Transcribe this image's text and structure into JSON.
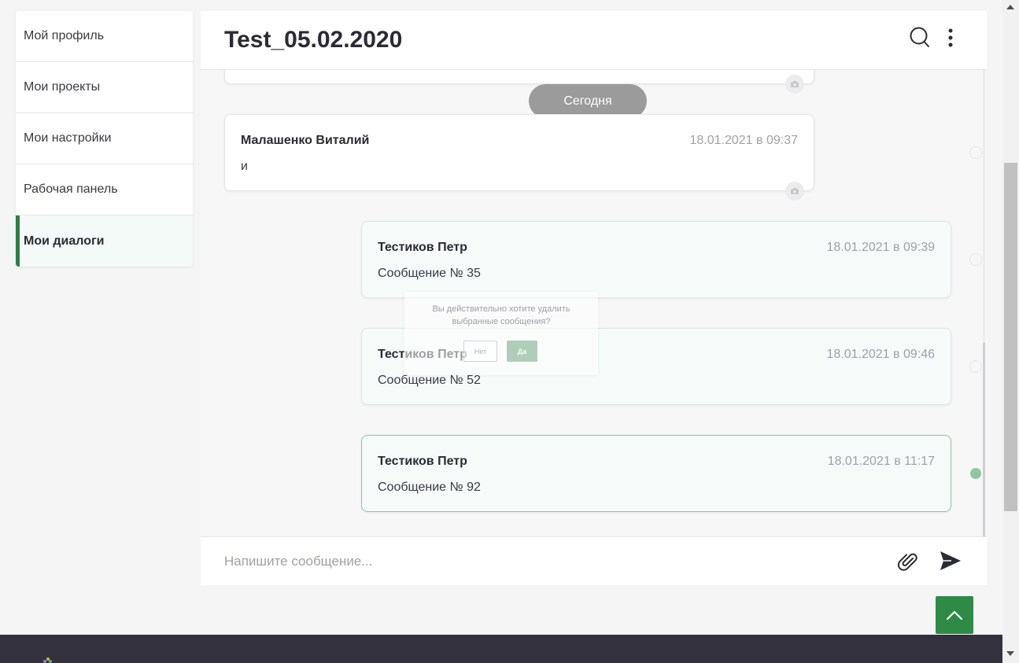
{
  "sidebar": {
    "items": [
      {
        "label": "Мой профиль"
      },
      {
        "label": "Мои проекты"
      },
      {
        "label": "Мои настройки"
      },
      {
        "label": "Рабочая панель"
      },
      {
        "label": "Мои диалоги",
        "active": true
      }
    ]
  },
  "chat": {
    "title": "Test_05.02.2020",
    "header_icons": [
      "search-icon",
      "more-vertical-icon"
    ],
    "day_separator": "Сегодня",
    "messages": [
      {
        "author": "Малашенко Виталий",
        "time": "18.01.2021 в 09:37",
        "text": "и"
      },
      {
        "author": "Тестиков Петр",
        "time": "18.01.2021 в 09:39",
        "text": "Сообщение № 35"
      },
      {
        "author": "Тестиков Петр",
        "time": "18.01.2021 в 09:46",
        "text": "Сообщение № 52"
      },
      {
        "author": "Тестиков Петр",
        "time": "18.01.2021 в 11:17",
        "text": "Сообщение № 92",
        "selected": true
      }
    ],
    "confirm_dialog": {
      "text": "Вы действительно хотите удалить выбранные сообщения?",
      "no_label": "Нет",
      "yes_label": "Да"
    },
    "composer": {
      "placeholder": "Напишите сообщение...",
      "icons": [
        "paperclip-icon",
        "send-icon"
      ]
    }
  },
  "colors": {
    "accent": "#2e8b45",
    "selected_dot": "#8fc79e",
    "footer": "#34313f",
    "day_pill": "#9b9b9b"
  }
}
